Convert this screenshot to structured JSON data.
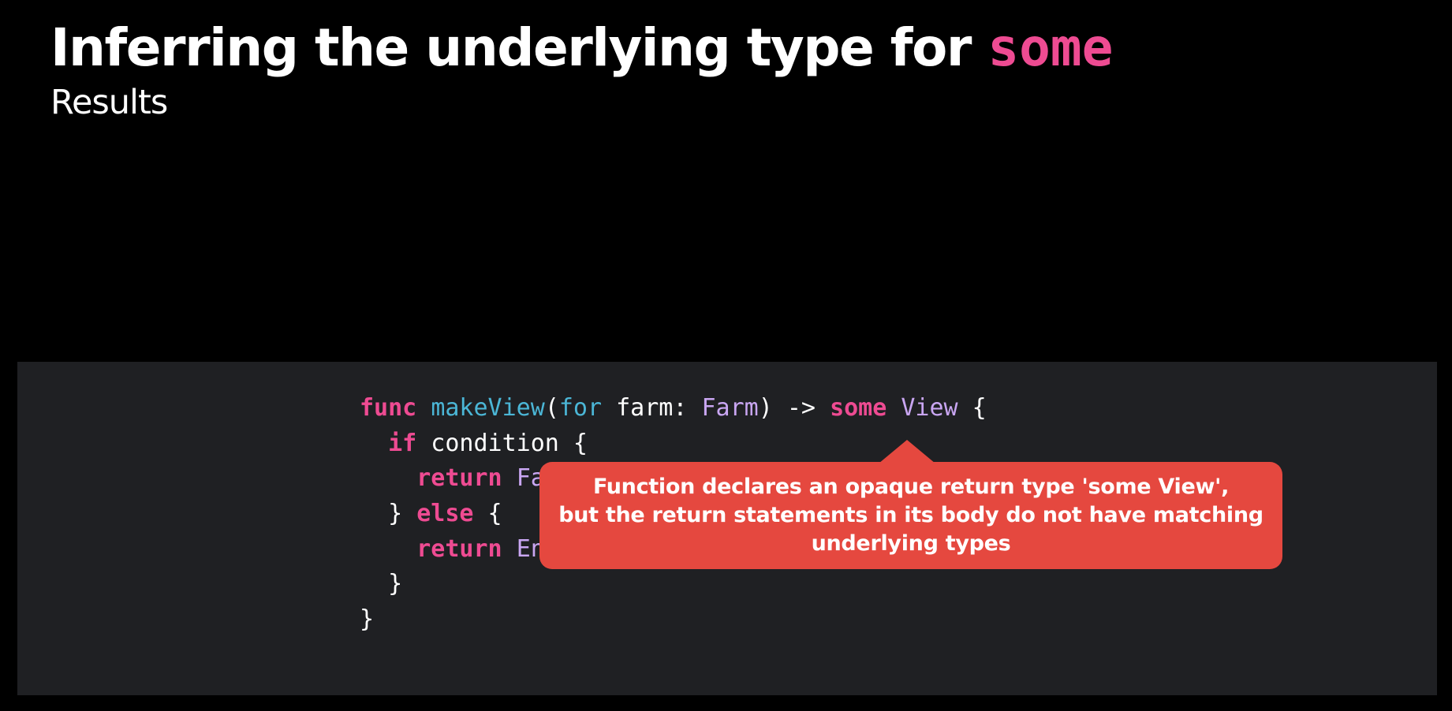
{
  "slide": {
    "title_prefix": "Inferring the underlying type for ",
    "title_keyword": "some",
    "subtitle": "Results"
  },
  "code": {
    "line1": {
      "kw_func": "func",
      "fn_name": "makeView",
      "p_open": "(",
      "kw_for": "for",
      "param": " farm: ",
      "type_farm": "Farm",
      "arrow": ") -> ",
      "kw_some": "some",
      "sp": " ",
      "type_view": "View",
      "brace": " {"
    },
    "line2": {
      "indent": "  ",
      "kw_if": "if",
      "rest": " condition {"
    },
    "line3": {
      "indent": "    ",
      "kw_return": "return",
      "sp": " ",
      "visible": "Fa"
    },
    "line4": {
      "indent": "  ",
      "close": "} ",
      "kw_else": "else",
      "brace": " {"
    },
    "line5": {
      "indent": "    ",
      "kw_return": "return",
      "sp": " ",
      "visible": "En"
    },
    "line6": {
      "text": "  }"
    },
    "line7": {
      "text": "}"
    }
  },
  "callout": {
    "line1": "Function declares an opaque return type 'some View',",
    "line2": "but the return statements in its body do not have matching",
    "line3": "underlying types"
  },
  "colors": {
    "background": "#000000",
    "code_panel": "#1f2023",
    "keyword": "#ee4b92",
    "function": "#4bb6d6",
    "type": "#c9a6f2",
    "error_callout": "#e5483f"
  }
}
